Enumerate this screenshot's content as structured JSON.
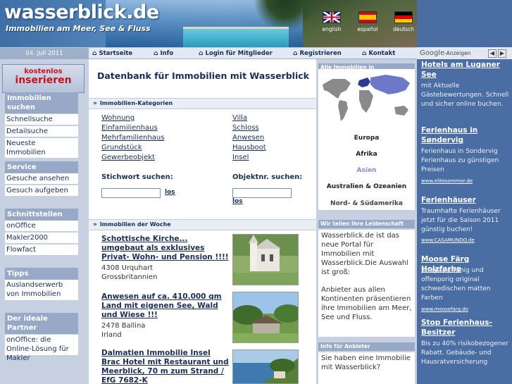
{
  "header": {
    "site_title": "wasserblick.de",
    "subtitle": "Immobilien am Meer, See & Fluss",
    "languages": [
      "english",
      "español",
      "deutsch"
    ]
  },
  "nav": {
    "date": "04. Juli 2011",
    "items": [
      "Startseite",
      "Info",
      "Login für Mitglieder",
      "Registrieren",
      "Kontakt"
    ]
  },
  "sidebar": {
    "promo_line1": "kostenlos",
    "promo_line2": "inserieren",
    "sections": [
      {
        "head": "Immobilien suchen",
        "items": [
          "Schnellsuche",
          "Detailsuche",
          "Neueste Immobilien"
        ]
      },
      {
        "head": "Service",
        "items": [
          "Gesuche ansehen",
          "Gesuch aufgeben"
        ]
      },
      {
        "head": "Schnittstellen",
        "items": [
          "onOffice",
          "Makler2000",
          "Flowfact"
        ]
      },
      {
        "head": "Tipps",
        "items": [
          "Auslandserwerb von Immobilien"
        ]
      },
      {
        "head": "Der ideale Partner",
        "items": [
          "onOffice: die Online-Lösung für Makler"
        ]
      }
    ]
  },
  "main": {
    "title": "Datenbank für Immobilien mit Wasserblick",
    "categories_head": "Immobilien-Kategorien",
    "categories_left": [
      "Wohnung",
      "Einfamilienhaus",
      "Mehrfamilienhaus",
      "Grundstück",
      "Gewerbeobjekt"
    ],
    "categories_right": [
      "Villa",
      "Schloss",
      "Anwesen",
      "Hausboot",
      "Insel"
    ],
    "keyword_label": "Stichwort suchen:",
    "objectnr_label": "Objektnr. suchen:",
    "go_label": "los",
    "week_head": "Immobilien der Woche",
    "properties": [
      {
        "title": "Schottische Kirche... umgebaut als exklusives Privat- Wohn- und Pension !!!!",
        "loc1": "4308 Urquhart",
        "loc2": "Grossbritannien"
      },
      {
        "title": "Anwesen auf ca. 410.000 qm Land mit eigenen See, Wald und Wiese !!!",
        "loc1": "2478 Ballina",
        "loc2": "Irland"
      },
      {
        "title": "Dalmatien Immobilie Insel Brac Hotel mit Restaurant und Meerblick, 70 m zum Strand / EfG 7682-K",
        "loc1": "",
        "loc2": ""
      }
    ]
  },
  "right": {
    "all_head": "Alle Immobilien in",
    "regions": [
      "Europa",
      "Afrika",
      "Asien",
      "Australien & Ozeanien",
      "Nord- & Südamerika"
    ],
    "region_colors": [
      "#1a2e55",
      "#1a2e55",
      "#7f8fc8",
      "#1a2e55",
      "#444444"
    ],
    "passion_head": "Wir teilen Ihre Leidenschaft",
    "passion_text": "Wasserblick.de ist das neue Portal für Immobilien mit Wasserblick.Die Auswahl ist groß:",
    "passion_text2": "Anbieter aus allen Kontinenten präsentieren ihre Immobilien am Meer, See und Fluss.",
    "anbieter_head": "Info für Anbieter",
    "anbieter_text": "Sie haben eine Immobilie mit Wasserblick?"
  },
  "ads": {
    "google": "Google",
    "label": "-Anzeigen",
    "items": [
      {
        "title": "Hotels am Luganer See",
        "text": "mit Aktuelle Gästebewertungen. Schnell und sicher online buchen.",
        "url": ""
      },
      {
        "title": "Ferienhaus in Søndervig",
        "text": "Ferienhaus in Sondervig Ferienhaus zu günstigen Preisen",
        "url": "www.elitesommer.de"
      },
      {
        "title": "Ferienhäuser",
        "text": "Traumhafte Ferienhäuser jetzt für die Saison 2011 günstig buchen!",
        "url": "www.CASAMUNDO.de"
      },
      {
        "title": "Moose Färg Holzfarbe",
        "text": "Strapazierfähig und offenporig original schwedischen matten Farben",
        "url": "www.moosefarg.de"
      },
      {
        "title": "Stop Ferienhaus-Besitzer",
        "text": "Bis zu 40% risikobezogener Rabatt. Gebäude- und Hausratversicherung",
        "url": ""
      }
    ]
  }
}
